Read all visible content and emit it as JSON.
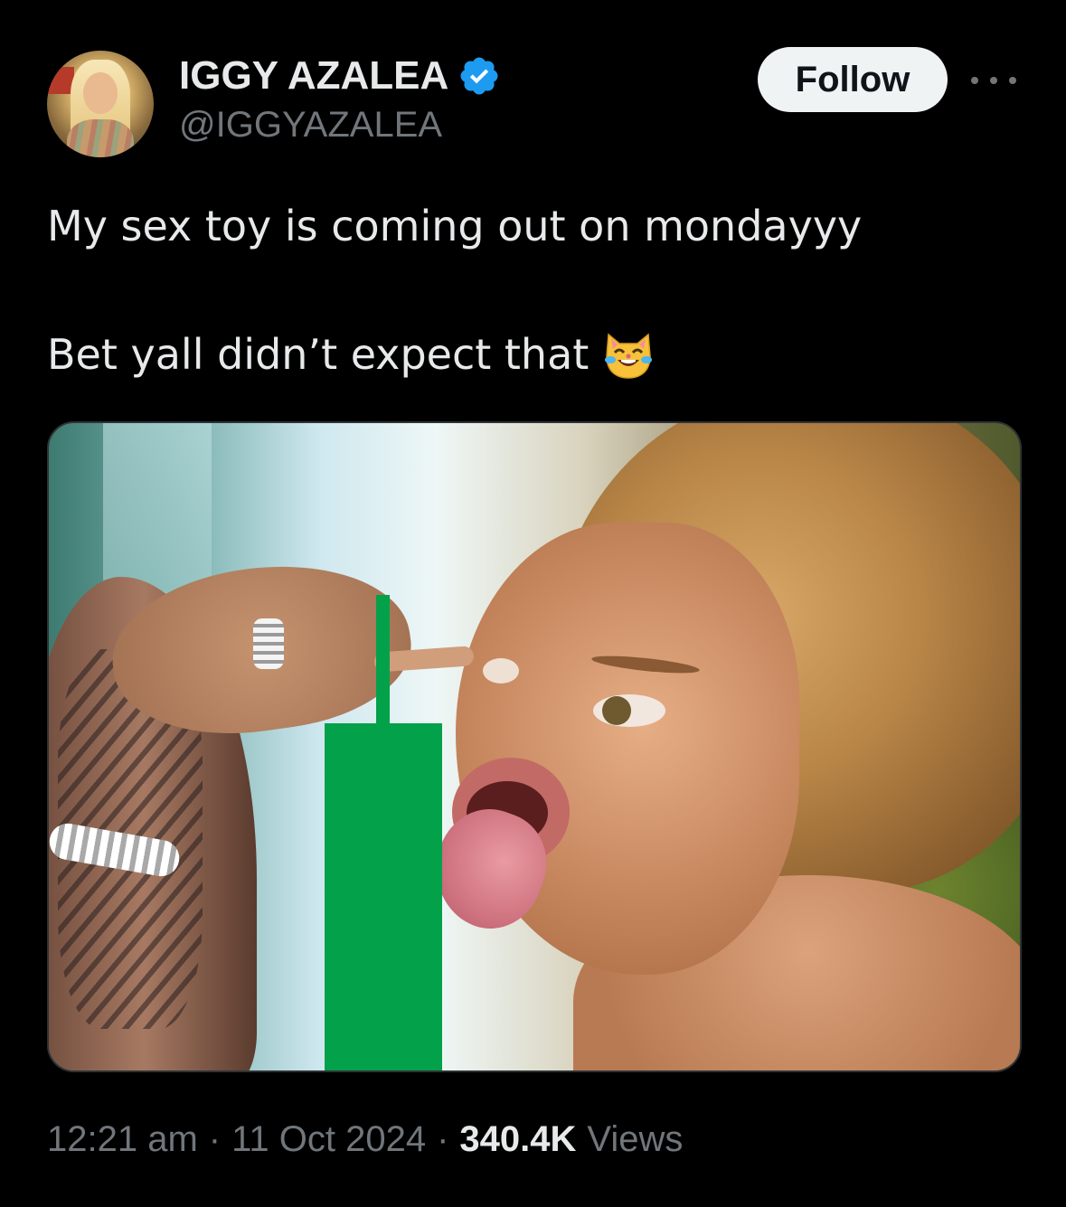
{
  "author": {
    "display_name": "IGGY AZALEA",
    "handle": "@IGGYAZALEA",
    "verified": true,
    "verified_color": "#1d9bf0"
  },
  "actions": {
    "follow_label": "Follow",
    "more_icon": "more-horizontal-icon"
  },
  "tweet": {
    "line1": "My sex toy is coming out on mondayyy",
    "line2": "Bet yall didn’t expect that",
    "emoji": "cat-face-with-tears-of-joy"
  },
  "media": {
    "overlay_color": "#02a14a"
  },
  "meta": {
    "time": "12:21 am",
    "date": "11 Oct 2024",
    "separator": "·",
    "views_count": "340.4K",
    "views_label": "Views"
  },
  "colors": {
    "background": "#000000",
    "text_primary": "#e7e9ea",
    "text_secondary": "#71767b",
    "follow_bg": "#eff3f4"
  }
}
